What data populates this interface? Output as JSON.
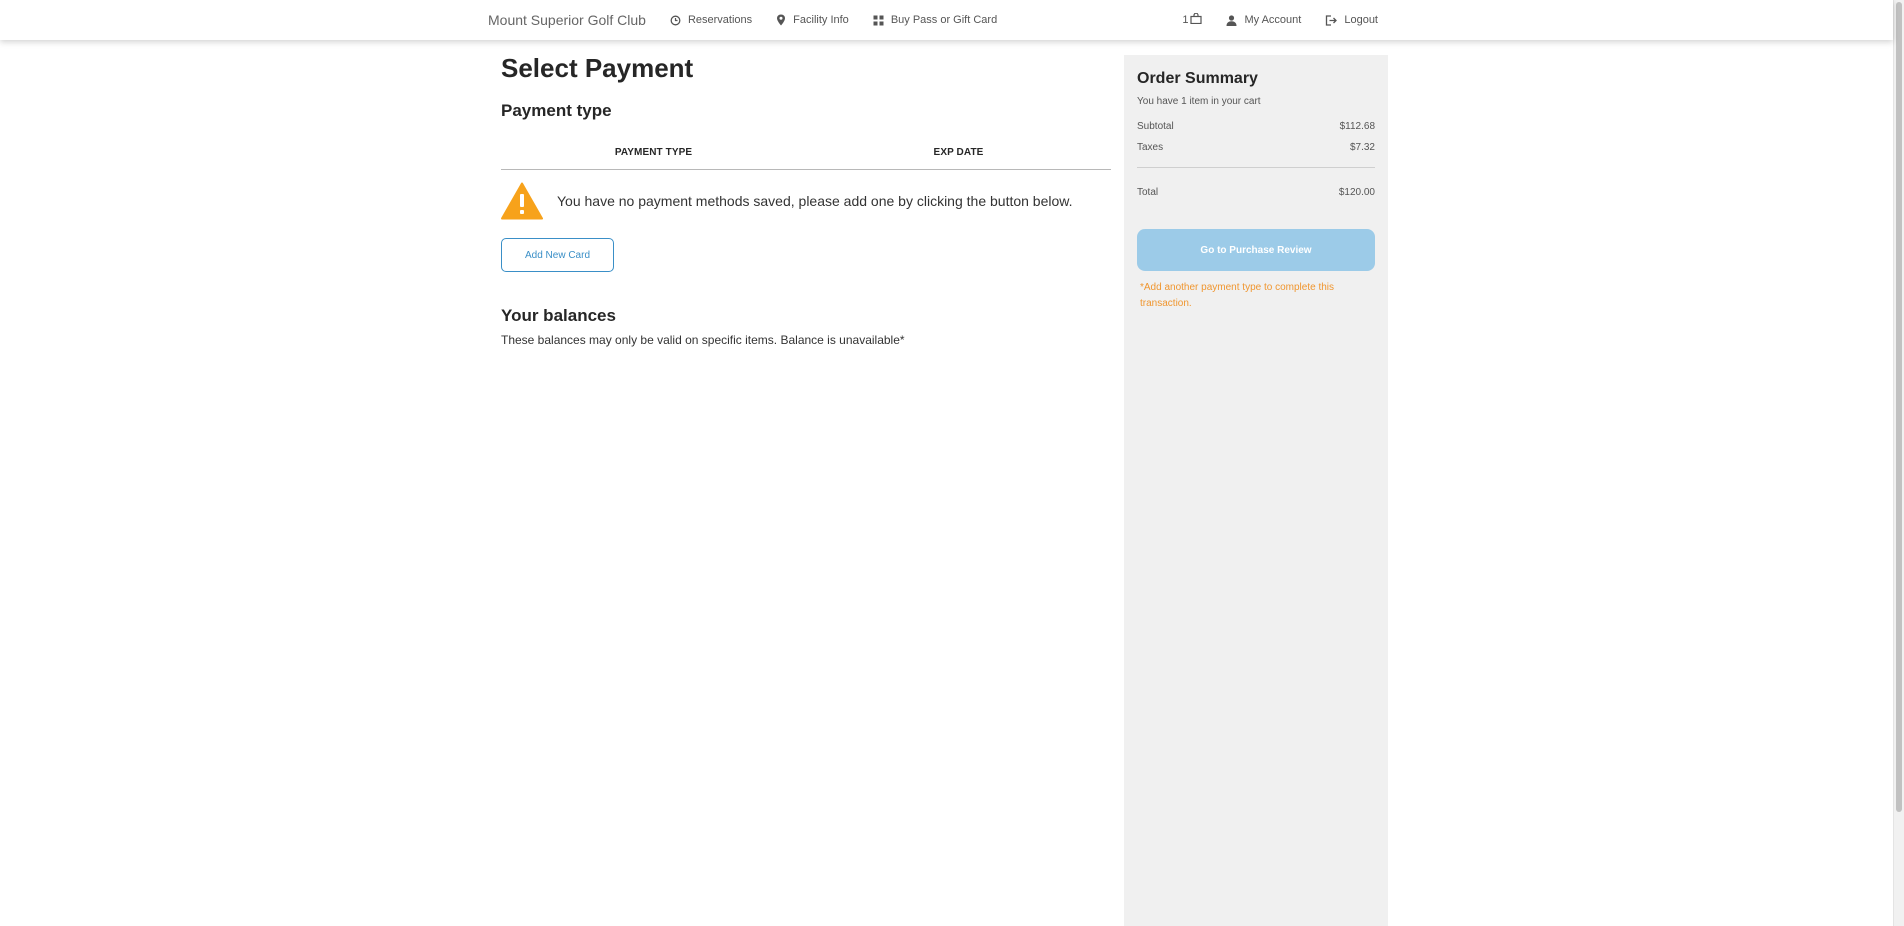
{
  "nav": {
    "brand": "Mount Superior Golf Club",
    "links": [
      {
        "label": "Reservations",
        "icon": "clock-icon"
      },
      {
        "label": "Facility Info",
        "icon": "map-pin-icon"
      },
      {
        "label": "Buy Pass or Gift Card",
        "icon": "grid-icon"
      }
    ],
    "cart_count": "1",
    "account_label": "My Account",
    "logout_label": "Logout"
  },
  "main": {
    "title": "Select Payment",
    "payment_type_heading": "Payment type",
    "columns": [
      "PAYMENT TYPE",
      "EXP DATE"
    ],
    "alert_text": "You have no payment methods saved, please add one by clicking the button below.",
    "add_card_label": "Add New Card",
    "balances_heading": "Your balances",
    "balances_text": "These balances may only be valid on specific items. Balance is unavailable*"
  },
  "summary": {
    "title": "Order Summary",
    "items_text": "You have 1 item in your cart",
    "subtotal_label": "Subtotal",
    "subtotal_value": "$112.68",
    "taxes_label": "Taxes",
    "taxes_value": "$7.32",
    "total_label": "Total",
    "total_value": "$120.00",
    "review_button": "Go to Purchase Review",
    "note": "*Add another payment type to complete this transaction."
  },
  "colors": {
    "accent": "#3a8fc7",
    "button_disabled": "#9ccbe8",
    "warning": "#f7a21b",
    "note": "#f0962f"
  }
}
